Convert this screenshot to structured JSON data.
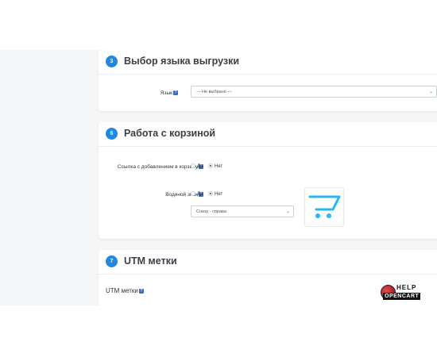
{
  "sections": [
    {
      "number": "3",
      "title": "Выбор языка выгрузки"
    },
    {
      "number": "6",
      "title": "Работа с корзиной"
    },
    {
      "number": "7",
      "title": "UTM метки"
    }
  ],
  "language": {
    "label": "Язык",
    "help": "?",
    "value": "--- Не выбрано ---",
    "caret": "⌄"
  },
  "cart": {
    "add_link_label": "Ссылка с добавлением в корзину",
    "watermark_label": "Водяной знак",
    "help": "?",
    "yes": "Да",
    "no": "Нет",
    "position_value": "Снизу - справа",
    "caret": "⌄"
  },
  "utm": {
    "label": "UTM метки",
    "help": "?"
  },
  "logo": {
    "line1": "HELP",
    "line2": "OPENCART"
  },
  "colors": {
    "accent": "#1e88e5",
    "cart_icon": "#29b6f6"
  }
}
